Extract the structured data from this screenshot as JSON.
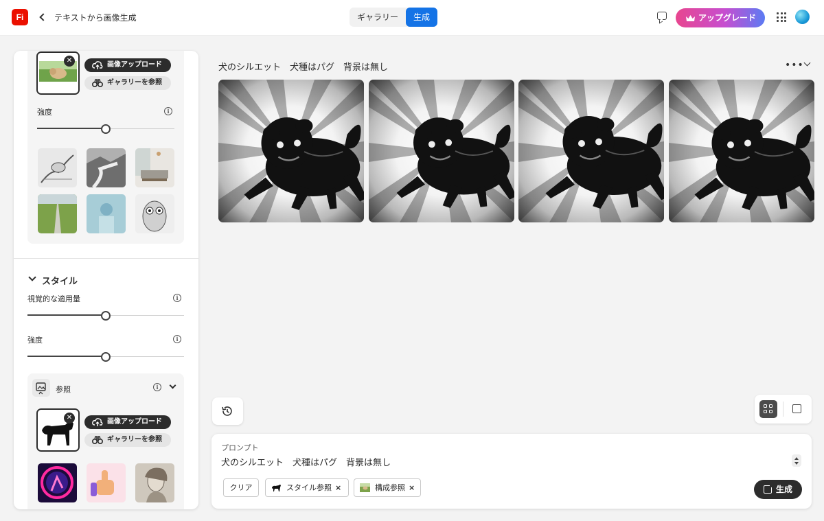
{
  "header": {
    "logo": "Fi",
    "title": "テキストから画像生成",
    "tabs": [
      {
        "label": "ギャラリー",
        "active": false
      },
      {
        "label": "生成",
        "active": true
      }
    ],
    "upgrade_label": "アップグレード",
    "accent_color": "#1473e6",
    "brand_color": "#eb1000"
  },
  "composition_ref": {
    "upload_label": "画像アップロード",
    "gallery_label": "ギャラリーを参照",
    "strength_label": "強度",
    "strength_value": 0.5,
    "preset_thumbnails": [
      "bird-sketch",
      "river-landscape",
      "living-room",
      "road-field",
      "sphere-pedestal",
      "owl-sketch"
    ]
  },
  "style": {
    "section_title": "スタイル",
    "visual_intensity_label": "視覚的な適用量",
    "visual_intensity_value": 0.5,
    "strength_label": "強度",
    "strength_value": 0.5,
    "reference": {
      "label": "参照",
      "upload_label": "画像アップロード",
      "gallery_label": "ギャラリーを参照",
      "preset_thumbnails": [
        "neon-dancer",
        "thumbs-up-3d",
        "classical-portrait"
      ]
    }
  },
  "results": {
    "prompt_title": "犬のシルエット　犬種はパグ　背景は無し",
    "more_label": "•••",
    "images": [
      "pug-silhouette-1",
      "pug-silhouette-2",
      "pug-silhouette-3",
      "pug-silhouette-4"
    ]
  },
  "prompt_panel": {
    "label": "プロンプト",
    "text": "犬のシルエット　犬種はパグ　背景は無し",
    "clear_label": "クリア",
    "chips": [
      {
        "label": "スタイル参照",
        "close": "×"
      },
      {
        "label": "構成参照",
        "close": "×"
      }
    ],
    "generate_label": "生成"
  }
}
